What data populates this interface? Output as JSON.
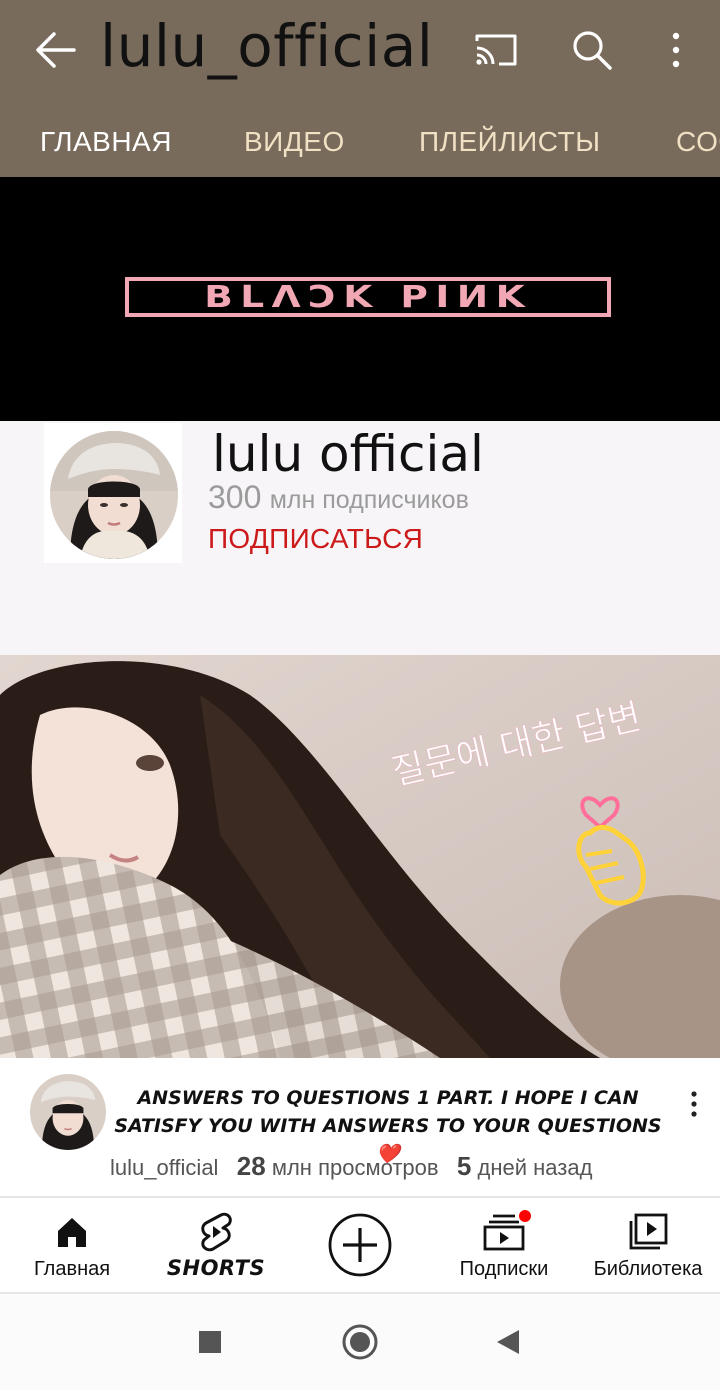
{
  "header": {
    "title": "lulu_official",
    "back_icon": "arrow-left-icon",
    "cast_icon": "cast-icon",
    "search_icon": "search-icon",
    "more_icon": "more-vertical-icon"
  },
  "tabs": [
    {
      "label": "ГЛАВНАЯ",
      "active": true
    },
    {
      "label": "ВИДЕО",
      "active": false
    },
    {
      "label": "ПЛЕЙЛИСТЫ",
      "active": false
    },
    {
      "label": "СОО",
      "active": false
    }
  ],
  "banner": {
    "logo_text": "BLΛƆK PIИK"
  },
  "channel": {
    "name": "lulu official",
    "subscribers_count": "300",
    "subscribers_label": "млн подписчиков",
    "subscribe_label": "ПОДПИСАТЬСЯ"
  },
  "video": {
    "thumbnail_caption": "질문에 대한 답변",
    "title": "Answers to questions 1 part. I hope I can satisfy you with answers to your questions❤️",
    "channel": "lulu_official",
    "views_count": "28",
    "views_label": "млн просмотров",
    "age_count": "5",
    "age_label": "дней назад"
  },
  "bottom_nav": {
    "home": "Главная",
    "shorts": "SHORTS",
    "subscriptions": "Подписки",
    "library": "Библиотека"
  },
  "colors": {
    "header_bg": "#786b5b",
    "tab_text": "#f0e0c4",
    "subscribe_red": "#cc1a1a",
    "banner_pink": "#f2a7b5",
    "notification_dot": "#ff0000"
  }
}
